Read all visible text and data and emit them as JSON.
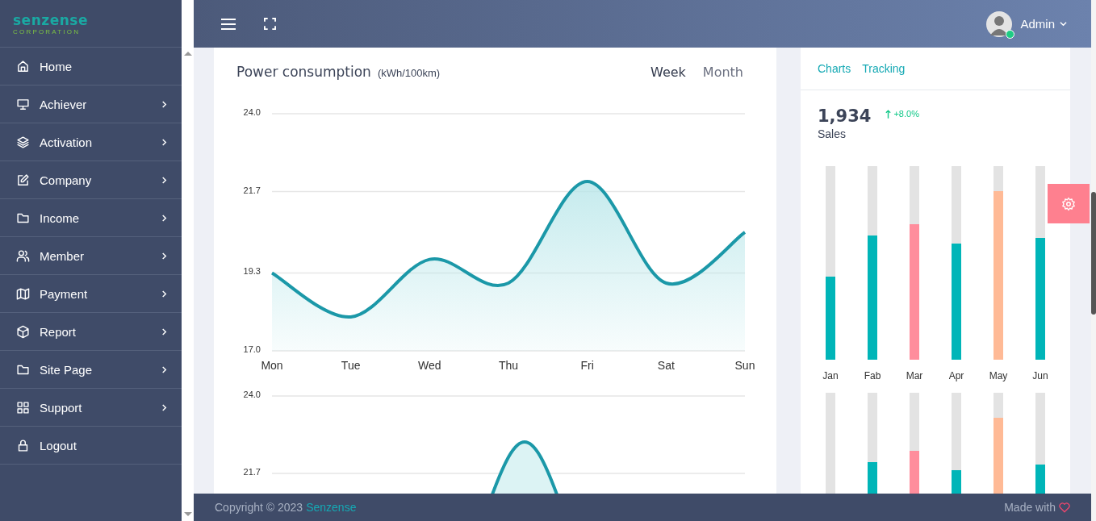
{
  "brand": {
    "name": "senzense",
    "tagline": "CORPORATION"
  },
  "sidebar": {
    "items": [
      {
        "label": "Home",
        "has_submenu": false
      },
      {
        "label": "Achiever",
        "has_submenu": true
      },
      {
        "label": "Activation",
        "has_submenu": true
      },
      {
        "label": "Company",
        "has_submenu": true
      },
      {
        "label": "Income",
        "has_submenu": true
      },
      {
        "label": "Member",
        "has_submenu": true
      },
      {
        "label": "Payment",
        "has_submenu": true
      },
      {
        "label": "Report",
        "has_submenu": true
      },
      {
        "label": "Site Page",
        "has_submenu": true
      },
      {
        "label": "Support",
        "has_submenu": true
      },
      {
        "label": "Logout",
        "has_submenu": false
      }
    ]
  },
  "topbar": {
    "user": {
      "name": "Admin",
      "online": true
    }
  },
  "power_card": {
    "title": "Power consumption",
    "unit": "(kWh/100km)",
    "tabs": [
      {
        "label": "Week",
        "selected": true
      },
      {
        "label": "Month",
        "selected": false
      }
    ],
    "chart_data": {
      "type": "area",
      "categories": [
        "Mon",
        "Tue",
        "Wed",
        "Thu",
        "Fri",
        "Sat",
        "Sun"
      ],
      "series": [
        {
          "color": "#1b98a8",
          "values": [
            19.3,
            18.0,
            19.7,
            19.0,
            22.0,
            19.0,
            20.5
          ]
        }
      ],
      "ylim": [
        17.0,
        24.0
      ],
      "yticks": [
        {
          "value": 17.0,
          "label": "17.0"
        },
        {
          "value": 19.3,
          "label": "19.3"
        },
        {
          "value": 21.7,
          "label": "21.7"
        },
        {
          "value": 24.0,
          "label": "24.0"
        }
      ]
    },
    "second_chart": {
      "y_labels": [
        "24.0",
        "21.7"
      ]
    }
  },
  "sales_card": {
    "tabs": [
      {
        "label": "Charts"
      },
      {
        "label": "Tracking"
      }
    ],
    "total": "1,934",
    "change": "+8.0%",
    "label": "Sales",
    "bar_rows": [
      {
        "bars": [
          {
            "label": "Jan",
            "level": 0.43,
            "color": "#00b5b8"
          },
          {
            "label": "Fab",
            "level": 0.64,
            "color": "#00b5b8"
          },
          {
            "label": "Mar",
            "level": 0.7,
            "color": "#ff8d9c"
          },
          {
            "label": "Apr",
            "level": 0.6,
            "color": "#00b5b8"
          },
          {
            "label": "May",
            "level": 0.87,
            "color": "#ffba96"
          },
          {
            "label": "Jun",
            "level": 0.63,
            "color": "#00b5b8"
          }
        ]
      },
      {
        "bars": [
          {
            "level": 0
          },
          {
            "level": 0.64,
            "color": "#00b5b8"
          },
          {
            "level": 0.7,
            "color": "#ff8d9c"
          },
          {
            "level": 0.6,
            "color": "#00b5b8"
          },
          {
            "level": 0.87,
            "color": "#ffba96"
          },
          {
            "level": 0.63,
            "color": "#00b5b8"
          }
        ]
      }
    ]
  },
  "footer": {
    "copyright": "Copyright © 2023",
    "brand_link": "Senzense",
    "made_with": "Made with"
  }
}
